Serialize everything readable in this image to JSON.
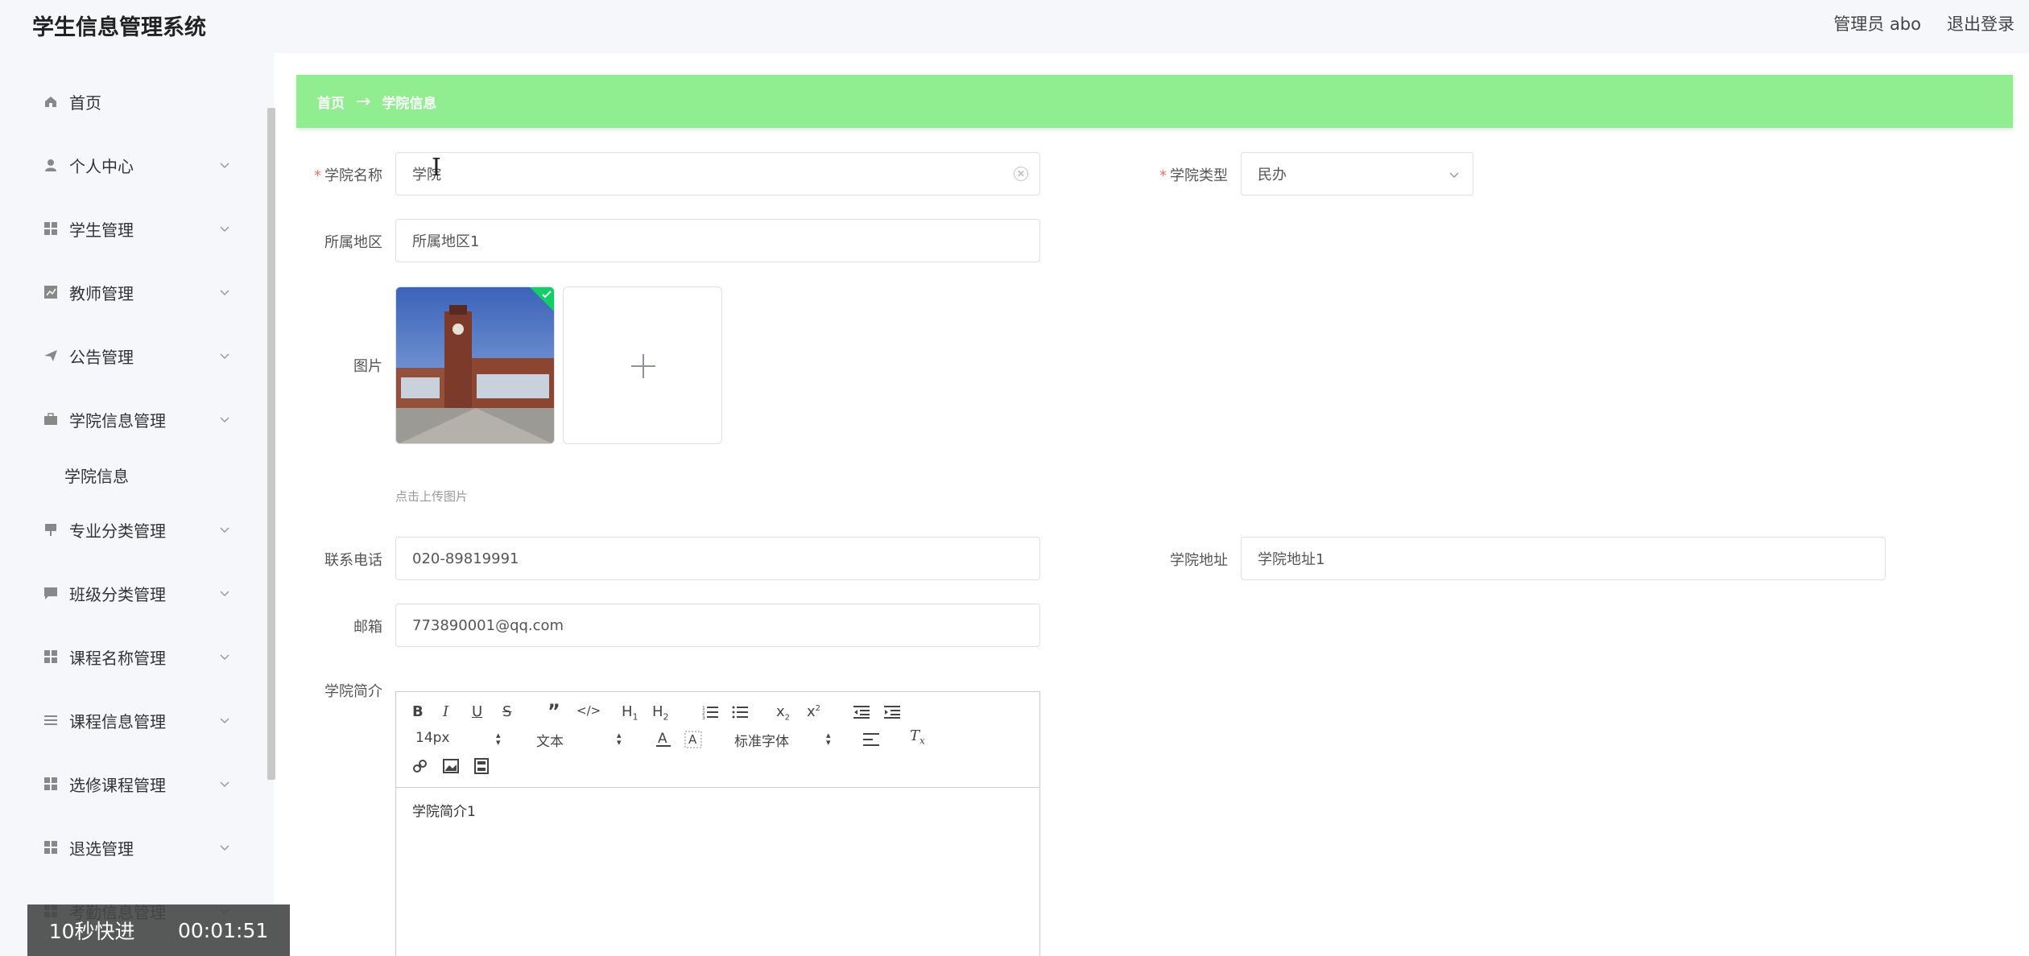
{
  "header": {
    "title": "学生信息管理系统",
    "user": "管理员 abo",
    "logout": "退出登录"
  },
  "sidebar": {
    "items": [
      {
        "label": "首页",
        "icon": "home-icon"
      },
      {
        "label": "个人中心",
        "icon": "user-icon"
      },
      {
        "label": "学生管理",
        "icon": "grid-icon"
      },
      {
        "label": "教师管理",
        "icon": "chart-icon"
      },
      {
        "label": "公告管理",
        "icon": "send-icon"
      },
      {
        "label": "学院信息管理",
        "icon": "briefcase-icon"
      },
      {
        "label": "学院信息",
        "icon": ""
      },
      {
        "label": "专业分类管理",
        "icon": "board-icon"
      },
      {
        "label": "班级分类管理",
        "icon": "message-icon"
      },
      {
        "label": "课程名称管理",
        "icon": "grid-icon"
      },
      {
        "label": "课程信息管理",
        "icon": "list-icon"
      },
      {
        "label": "选修课程管理",
        "icon": "grid-icon"
      },
      {
        "label": "退选管理",
        "icon": "grid-icon"
      },
      {
        "label": "考勤信息管理",
        "icon": "grid-icon"
      }
    ]
  },
  "breadcrumb": {
    "home": "首页",
    "arrow": "→",
    "current": "学院信息"
  },
  "form": {
    "name": {
      "label": "学院名称",
      "value": "学院"
    },
    "type": {
      "label": "学院类型",
      "value": "民办"
    },
    "region": {
      "label": "所属地区",
      "value": "所属地区1"
    },
    "image": {
      "label": "图片",
      "hint": "点击上传图片",
      "plus": "+"
    },
    "phone": {
      "label": "联系电话",
      "value": "020-89819991"
    },
    "address": {
      "label": "学院地址",
      "value": "学院地址1"
    },
    "email": {
      "label": "邮箱",
      "value": "773890001@qq.com"
    },
    "intro": {
      "label": "学院简介",
      "value": "学院简介1"
    }
  },
  "editor": {
    "font_size": "14px",
    "block_type": "文本",
    "font_family": "标准字体"
  },
  "overlay": {
    "skip": "10秒快进",
    "time": "00:01:51"
  },
  "colors": {
    "breadcrumb_bg": "#90ee90",
    "required": "#f56c6c"
  }
}
